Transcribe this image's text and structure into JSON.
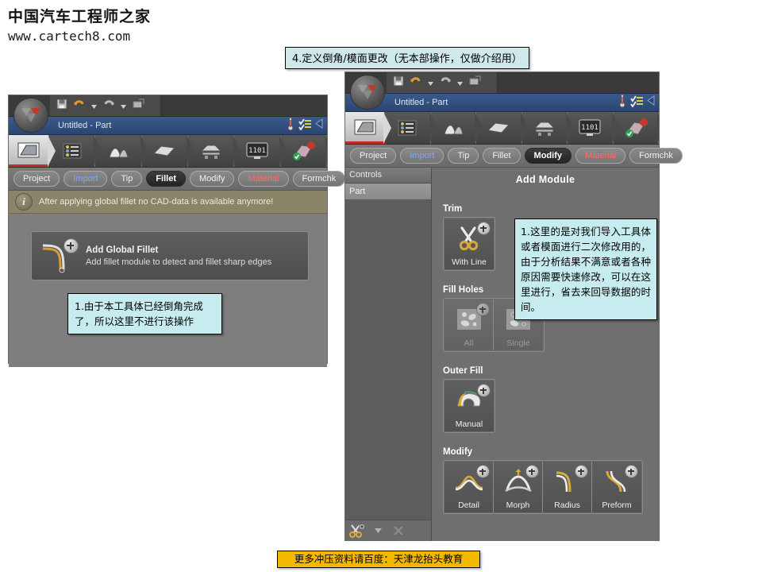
{
  "site": {
    "logo_cn": "中国汽车工程师之家",
    "url": "www.cartech8.com"
  },
  "title_banner": {
    "text": "4.定义倒角/模面更改（无本部操作，仅做介绍用）"
  },
  "bottom_banner": {
    "text": "更多冲压资料请百度：天津龙抬头教育"
  },
  "left_window": {
    "title": "Untitled - Part",
    "ribbon_icons": [
      "part-icon",
      "process-icon",
      "tools-icon",
      "blank-icon",
      "press-icon",
      "monitor-1101-icon",
      "results-icon"
    ],
    "tabs": [
      {
        "label": "Project",
        "state": "normal"
      },
      {
        "label": "Import",
        "state": "blue"
      },
      {
        "label": "Tip",
        "state": "normal"
      },
      {
        "label": "Fillet",
        "state": "active"
      },
      {
        "label": "Modify",
        "state": "normal"
      },
      {
        "label": "Material",
        "state": "red"
      },
      {
        "label": "Formchk",
        "state": "normal"
      }
    ],
    "info_message": "After applying global fillet no CAD-data is available anymore!",
    "module_card": {
      "title": "Add Global Fillet",
      "subtitle": "Add fillet module to detect and fillet sharp edges"
    },
    "annotation": "1.由于本工具体已经倒角完成了，所以这里不进行该操作"
  },
  "right_window": {
    "title": "Untitled - Part",
    "tabs": [
      {
        "label": "Project",
        "state": "normal"
      },
      {
        "label": "Import",
        "state": "blue"
      },
      {
        "label": "Tip",
        "state": "normal"
      },
      {
        "label": "Fillet",
        "state": "normal"
      },
      {
        "label": "Modify",
        "state": "active"
      },
      {
        "label": "Material",
        "state": "red"
      },
      {
        "label": "Formchk",
        "state": "normal"
      }
    ],
    "sidebar": {
      "header": "Controls",
      "items": [
        "Part"
      ],
      "tools": [
        "trim-add-icon",
        "dropdown-arrow-icon",
        "delete-icon"
      ]
    },
    "panel_title": "Add Module",
    "sections": [
      {
        "label": "Trim",
        "buttons": [
          {
            "label": "With Line",
            "icon": "scissors-icon",
            "disabled": false
          }
        ]
      },
      {
        "label": "Fill Holes",
        "buttons": [
          {
            "label": "All",
            "icon": "fill-all-icon",
            "disabled": true
          },
          {
            "label": "Single",
            "icon": "fill-single-icon",
            "disabled": true
          }
        ]
      },
      {
        "label": "Outer Fill",
        "buttons": [
          {
            "label": "Manual",
            "icon": "outer-fill-icon",
            "disabled": false
          }
        ]
      },
      {
        "label": "Modify",
        "buttons": [
          {
            "label": "Detail",
            "icon": "detail-icon",
            "disabled": false
          },
          {
            "label": "Morph",
            "icon": "morph-icon",
            "disabled": false
          },
          {
            "label": "Radius",
            "icon": "radius-icon",
            "disabled": false
          },
          {
            "label": "Preform",
            "icon": "preform-icon",
            "disabled": false
          }
        ]
      }
    ],
    "annotation": "1.这里的是对我们导入工具体或者模面进行二次修改用的，由于分析结果不满意或者各种原因需要快速修改，可以在这里进行，省去来回导数据的时间。"
  }
}
